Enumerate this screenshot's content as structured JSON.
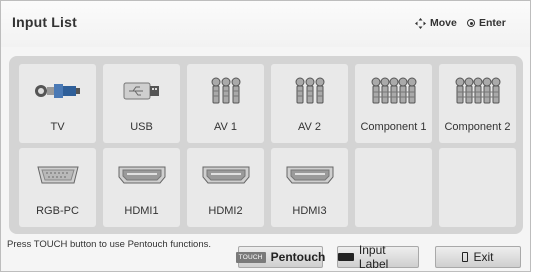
{
  "header": {
    "title": "Input List",
    "move_label": "Move",
    "enter_label": "Enter"
  },
  "inputs": [
    {
      "label": "TV",
      "icon": "antenna-connector-icon"
    },
    {
      "label": "USB",
      "icon": "usb-icon"
    },
    {
      "label": "AV 1",
      "icon": "rca-connectors-icon"
    },
    {
      "label": "AV 2",
      "icon": "rca-connectors-icon"
    },
    {
      "label": "Component 1",
      "icon": "component-connectors-icon"
    },
    {
      "label": "Component 2",
      "icon": "component-connectors-icon"
    },
    {
      "label": "RGB-PC",
      "icon": "vga-port-icon"
    },
    {
      "label": "HDMI1",
      "icon": "hdmi-port-icon"
    },
    {
      "label": "HDMI2",
      "icon": "hdmi-port-icon"
    },
    {
      "label": "HDMI3",
      "icon": "hdmi-port-icon"
    },
    {
      "label": "",
      "icon": ""
    },
    {
      "label": "",
      "icon": ""
    }
  ],
  "footer": {
    "hint": "Press TOUCH button to use Pentouch functions.",
    "touch_badge": "TOUCH",
    "pentouch_label": "Pentouch",
    "input_label": "Input Label",
    "exit_label": "Exit"
  }
}
